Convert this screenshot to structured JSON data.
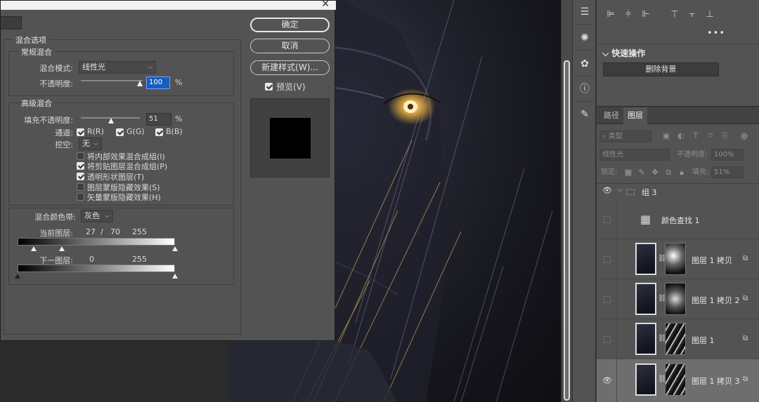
{
  "dialog": {
    "close_icon": "close-icon",
    "blend_options": {
      "legend": "混合选项",
      "general": {
        "legend": "常规混合",
        "blend_mode_label": "混合模式:",
        "blend_mode_value": "线性光",
        "opacity_label": "不透明度:",
        "opacity_value": "100",
        "opacity_unit": "%"
      },
      "advanced": {
        "legend": "高级混合",
        "fill_opacity_label": "填充不透明度:",
        "fill_opacity_value": "51",
        "fill_opacity_unit": "%",
        "channels_label": "通道:",
        "channel_r": "R(R)",
        "channel_g": "G(G)",
        "channel_b": "B(B)",
        "knockout_label": "挖空:",
        "knockout_value": "无",
        "options": [
          {
            "label": "将内部效果混合成组(I)",
            "checked": false
          },
          {
            "label": "将剪贴图层混合成组(P)",
            "checked": true
          },
          {
            "label": "透明形状图层(T)",
            "checked": true
          },
          {
            "label": "图层蒙版隐藏效果(S)",
            "checked": false
          },
          {
            "label": "矢量蒙版隐藏效果(H)",
            "checked": false
          }
        ]
      },
      "blend_if": {
        "label": "混合颜色带:",
        "value": "灰色",
        "this_layer_label": "当前图层:",
        "this_layer_values": [
          "27",
          "/",
          "70",
          "255"
        ],
        "underlying_label": "下一图层:",
        "underlying_values": [
          "0",
          "255"
        ]
      }
    },
    "buttons": {
      "ok": "确定",
      "cancel": "取消",
      "new_style": "新建样式(W)..."
    },
    "preview_label": "预览(V)",
    "preview_checked": true
  },
  "properties": {
    "more": "•••",
    "quick_actions_title": "快速操作",
    "remove_background": "删除背景"
  },
  "layers_panel": {
    "tabs": [
      "路径",
      "图层"
    ],
    "active_tab": "图层",
    "filter_kind": "类型",
    "blend_mode": "线性光",
    "opacity_label": "不透明度:",
    "opacity_value": "100%",
    "lock_label": "锁定:",
    "fill_label": "填充:",
    "fill_value": "51%",
    "layers": [
      {
        "name": "组 3",
        "type": "group",
        "visible": true
      },
      {
        "name": "颜色查找 1",
        "type": "adjustment",
        "visible": false
      },
      {
        "name": "图层 1 拷贝",
        "type": "pixel",
        "visible": false
      },
      {
        "name": "图层 1 拷贝 2",
        "type": "pixel",
        "visible": false
      },
      {
        "name": "图层 1",
        "type": "pixel",
        "visible": false
      },
      {
        "name": "图层 1 拷贝 3",
        "type": "pixel",
        "visible": true,
        "selected": true
      }
    ]
  },
  "colors": {
    "panel_bg": "#535353",
    "selection_blue": "#1a5ebd"
  }
}
